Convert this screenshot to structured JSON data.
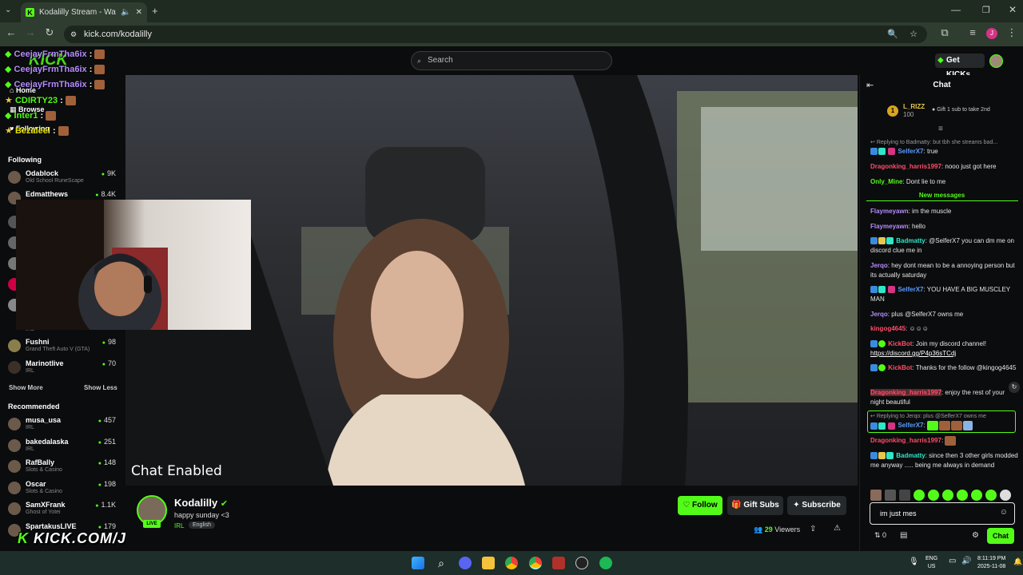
{
  "browser": {
    "tab_title": "Kodalilly Stream - Watch Li",
    "url": "kick.com/kodalilly",
    "profile_initial": "J"
  },
  "header": {
    "search_placeholder": "Search",
    "get_kicks_label": "Get KICKs"
  },
  "sidebar": {
    "nav": [
      "Home",
      "Browse",
      "Following"
    ],
    "following_heading": "Following",
    "following": [
      {
        "name": "Odablock",
        "category": "Old School RuneScape",
        "viewers": "9K"
      },
      {
        "name": "Edmatthews",
        "category": "",
        "viewers": "8.4K"
      },
      {
        "name": "Fushni",
        "category": "Grand Theft Auto V (GTA)",
        "viewers": "98"
      },
      {
        "name": "Marinotlive",
        "category": "IRL",
        "viewers": "70"
      }
    ],
    "partial_category": "IRL",
    "show_more": "Show More",
    "show_less": "Show Less",
    "recommended_heading": "Recommended",
    "recommended": [
      {
        "name": "musa_usa",
        "category": "IRL",
        "viewers": "457"
      },
      {
        "name": "bakedalaska",
        "category": "IRL",
        "viewers": "251"
      },
      {
        "name": "RafBally",
        "category": "Slots & Casino",
        "viewers": "148"
      },
      {
        "name": "Oscar",
        "category": "Slots & Casino",
        "viewers": "198"
      },
      {
        "name": "SamXFrank",
        "category": "Ghost of Yotei",
        "viewers": "1.1K"
      },
      {
        "name": "SpartakusLIVE",
        "category": "",
        "viewers": "179"
      }
    ]
  },
  "overlay_chat": [
    {
      "user": "CeejayFrmTha6ix",
      "sep": " :",
      "color": "#b48cff"
    },
    {
      "user": "CeejayFrmTha6ix",
      "sep": " :",
      "color": "#b48cff"
    },
    {
      "user": "CeejayFrmTha6ix",
      "sep": " :",
      "color": "#b48cff"
    },
    {
      "user": "CDIRTY23",
      "sep": " :",
      "color": "#53fc18"
    },
    {
      "user": "Inter1",
      "sep": " :",
      "color": "#53fc18"
    },
    {
      "user": "Bezaleel",
      "sep": " :",
      "color": "#e6e600"
    }
  ],
  "overlay_logo": {
    "brand": "KICK",
    "text": "KICK.COM/JERQO"
  },
  "video": {
    "overlay_text": "Chat Enabled"
  },
  "stream": {
    "streamer": "Kodalilly",
    "title": "happy sunday <3",
    "category": "IRL",
    "tag": "English",
    "live_badge": "LIVE",
    "follow_label": "Follow",
    "gift_subs_label": "Gift Subs",
    "subscribe_label": "Subscribe",
    "viewers": "29",
    "viewers_label": "Viewers"
  },
  "chat": {
    "title": "Chat",
    "leader": {
      "rank": "1",
      "name": "L_RIZZ",
      "amount": "100"
    },
    "gift_prompt": "Gift 1 sub to take 2nd",
    "reply_1": "Replying to Badmatty: but tbh she streams bad...",
    "new_messages": "New messages",
    "reply_2": "Replying to Jerqo: plus @SelferX7 owns me",
    "messages": [
      {
        "user": "SelferX7",
        "color": "#5a9bff",
        "text": ": true"
      },
      {
        "user": "Dragonking_harris1997",
        "color": "#ff4d6a",
        "text": ": nooo just got here"
      },
      {
        "user": "Only_Mine",
        "color": "#53fc18",
        "text": ": Dont lie to me"
      },
      {
        "user": "Flaymeyawn",
        "color": "#b48cff",
        "text": ": im the muscle"
      },
      {
        "user": "Flaymeyawn",
        "color": "#b48cff",
        "text": ": hello"
      },
      {
        "user": "Badmatty",
        "color": "#2ee6c8",
        "text": ": @SelferX7 you can dm me on discord clue me in"
      },
      {
        "user": "Jerqo",
        "color": "#b48cff",
        "text": ": hey dont mean to be a annoying person but its actually saturday"
      },
      {
        "user": "SelferX7",
        "color": "#5a9bff",
        "text": ": YOU HAVE A BIG MUSCLEY MAN"
      },
      {
        "user": "Jerqo",
        "color": "#b48cff",
        "text": ": plus @SelferX7 owns me"
      },
      {
        "user": "kingog4645",
        "color": "#ff4d6a",
        "text": ": ☺☺☺"
      },
      {
        "user": "KickBot",
        "color": "#ff4d6a",
        "text": ": Join my discord channel!",
        "link": "https://discord.gg/P4p36sTCdj"
      },
      {
        "user": "KickBot",
        "color": "#ff4d6a",
        "text": ": Thanks for the follow @kingog4645"
      },
      {
        "user": "Dragonking_harris1997",
        "color": "#ff4d6a",
        "text": ": enjoy the rest of your night beautiful"
      },
      {
        "user": "SelferX7",
        "color": "#5a9bff",
        "text": ":"
      },
      {
        "user": "Dragonking_harris1997",
        "color": "#ff4d6a",
        "text": ":"
      },
      {
        "user": "Badmatty",
        "color": "#2ee6c8",
        "text": ": since then 3 other girls modded me anyway ..... being me always in demand"
      }
    ],
    "input_value": "im just mes",
    "kicks_count": "0",
    "send_label": "Chat"
  },
  "taskbar": {
    "lang_top": "ENG",
    "lang_bottom": "US",
    "time": "8:11:19 PM",
    "date": "2025-11-08"
  }
}
